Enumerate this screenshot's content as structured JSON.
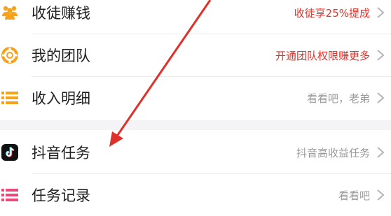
{
  "menu": {
    "items": [
      {
        "label": "收徒赚钱",
        "right": "收徒享25%提成",
        "right_color": "#e5332a",
        "icon": "people-icon"
      },
      {
        "label": "我的团队",
        "right": "开通团队权限赚更多",
        "right_color": "#e5332a",
        "icon": "lifebuoy-icon"
      },
      {
        "label": "收入明细",
        "right": "看看吧，老弟",
        "right_color": "#9a9a9a",
        "icon": "list-icon"
      },
      {
        "label": "抖音任务",
        "right": "抖音高收益任务",
        "right_color": "#9a9a9a",
        "icon": "tiktok-icon"
      },
      {
        "label": "任务记录",
        "right": "看看吧",
        "right_color": "#9a9a9a",
        "icon": "record-list-icon"
      }
    ]
  },
  "annotation": {
    "arrow_color": "#e0302a"
  },
  "colors": {
    "accent_orange": "#f7a21b",
    "accent_red": "#e5332a",
    "tiktok_black": "#111111"
  }
}
